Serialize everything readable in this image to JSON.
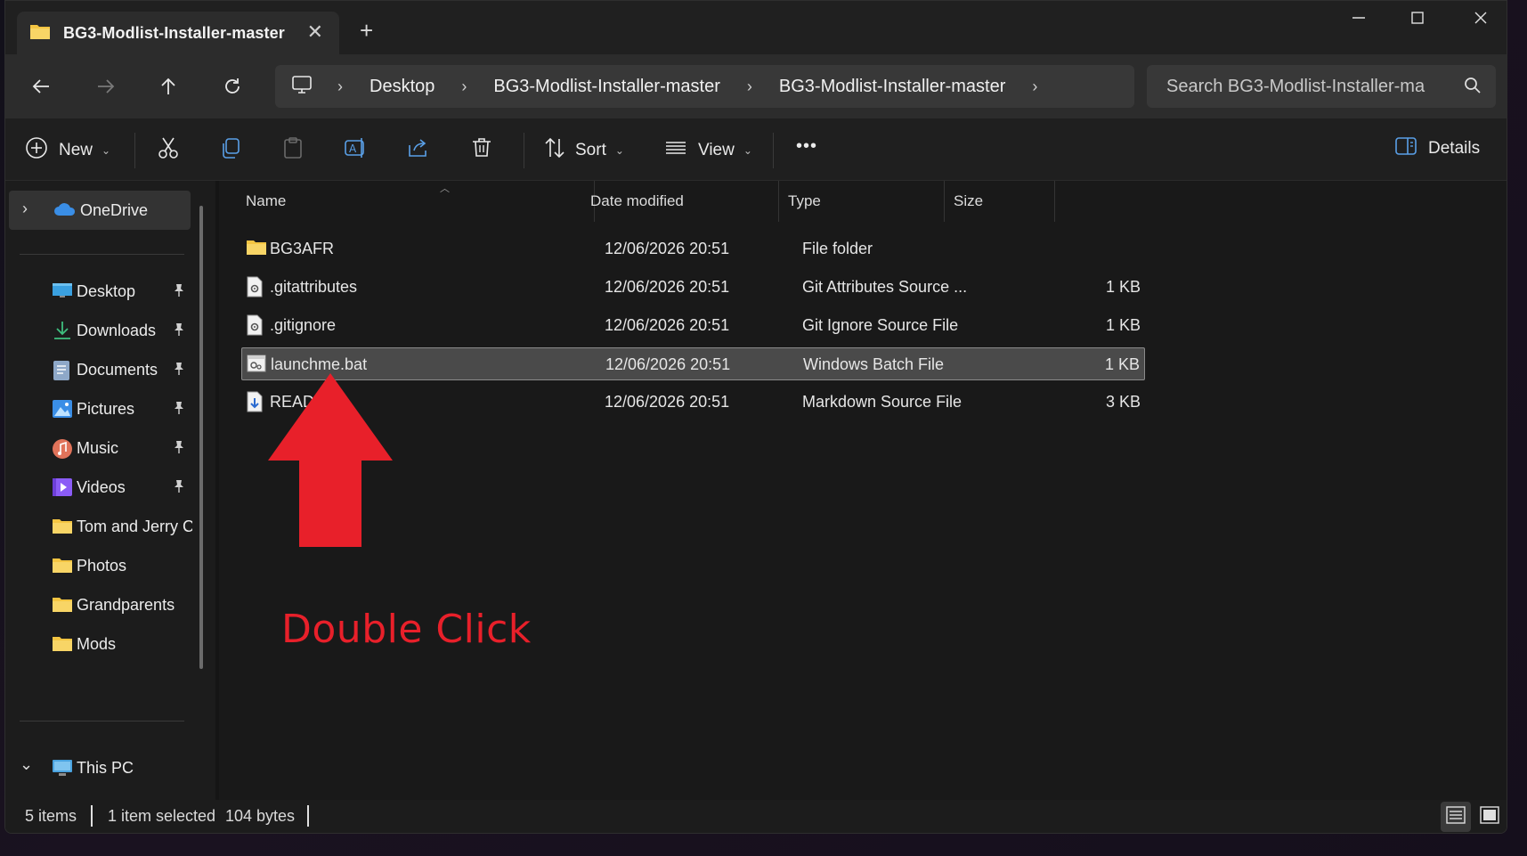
{
  "window": {
    "tab_title": "BG3-Modlist-Installer-master",
    "controls": {
      "minimize": "—",
      "maximize": "☐",
      "close": "✕"
    }
  },
  "nav": {
    "breadcrumbs": [
      "Desktop",
      "BG3-Modlist-Installer-master",
      "BG3-Modlist-Installer-master"
    ],
    "search_placeholder": "Search BG3-Modlist-Installer-ma"
  },
  "toolbar": {
    "new_label": "New",
    "sort_label": "Sort",
    "view_label": "View",
    "more_label": "•••",
    "details_label": "Details"
  },
  "sidebar": {
    "onedrive": "OneDrive",
    "quick": [
      {
        "label": "Desktop",
        "icon": "desktop-icon",
        "pinned": true
      },
      {
        "label": "Downloads",
        "icon": "download-icon",
        "pinned": true
      },
      {
        "label": "Documents",
        "icon": "documents-icon",
        "pinned": true
      },
      {
        "label": "Pictures",
        "icon": "pictures-icon",
        "pinned": true
      },
      {
        "label": "Music",
        "icon": "music-icon",
        "pinned": true
      },
      {
        "label": "Videos",
        "icon": "videos-icon",
        "pinned": true
      },
      {
        "label": "Tom and Jerry C",
        "icon": "folder-icon",
        "pinned": false
      },
      {
        "label": "Photos",
        "icon": "folder-icon",
        "pinned": false
      },
      {
        "label": "Grandparents",
        "icon": "folder-icon",
        "pinned": false
      },
      {
        "label": "Mods",
        "icon": "folder-icon",
        "pinned": false
      }
    ],
    "this_pc": "This PC"
  },
  "columns": {
    "name": "Name",
    "date": "Date modified",
    "type": "Type",
    "size": "Size"
  },
  "files": [
    {
      "name": "BG3AFR",
      "date": "12/06/2026 20:51",
      "type": "File folder",
      "size": "",
      "icon": "folder-icon"
    },
    {
      "name": ".gitattributes",
      "date": "12/06/2026 20:51",
      "type": "Git Attributes Source ...",
      "size": "1 KB",
      "icon": "settings-file-icon"
    },
    {
      "name": ".gitignore",
      "date": "12/06/2026 20:51",
      "type": "Git Ignore Source File",
      "size": "1 KB",
      "icon": "settings-file-icon"
    },
    {
      "name": "launchme.bat",
      "date": "12/06/2026 20:51",
      "type": "Windows Batch File",
      "size": "1 KB",
      "icon": "batch-file-icon",
      "selected": true
    },
    {
      "name": "READ     nd",
      "date": "12/06/2026 20:51",
      "type": "Markdown Source File",
      "size": "3 KB",
      "icon": "markdown-file-icon"
    }
  ],
  "annotation": {
    "text": "Double Click",
    "color": "#e8202a"
  },
  "status": {
    "items": "5 items",
    "selected": "1 item selected",
    "bytes": "104 bytes"
  },
  "colors": {
    "accent_folder": "#f4c542",
    "onedrive": "#3a8ee6",
    "annotation_red": "#e8202a"
  }
}
